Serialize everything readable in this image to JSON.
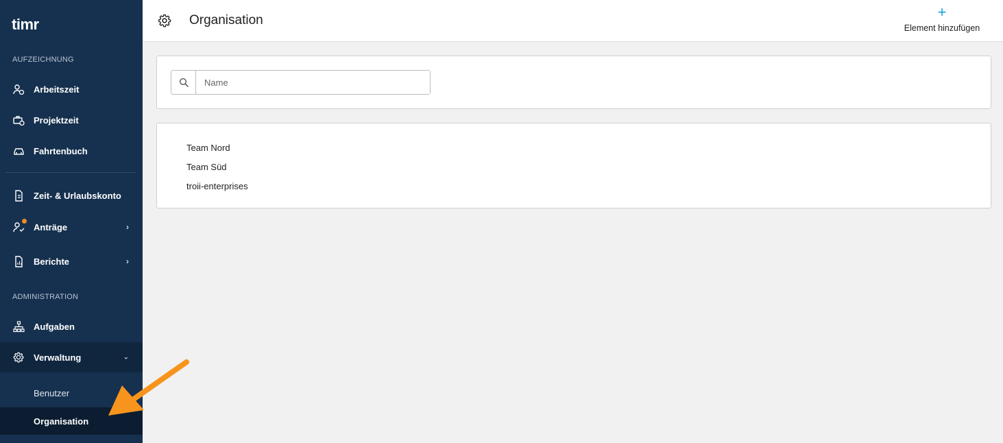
{
  "sidebar": {
    "logo": "timr",
    "sections": {
      "recording": "AUFZEICHNUNG",
      "administration": "ADMINISTRATION"
    },
    "items": {
      "arbeitszeit": "Arbeitszeit",
      "projektzeit": "Projektzeit",
      "fahrtenbuch": "Fahrtenbuch",
      "urlaubskonto": "Zeit- & Urlaubskonto",
      "antraege": "Anträge",
      "berichte": "Berichte",
      "aufgaben": "Aufgaben",
      "verwaltung": "Verwaltung"
    },
    "subitems": {
      "benutzer": "Benutzer",
      "organisation": "Organisation"
    },
    "badge_color": "#f28c1e"
  },
  "header": {
    "title": "Organisation",
    "add_label": "Element hinzufügen",
    "add_icon": "plus-icon",
    "accent": "#1aa1e0"
  },
  "search": {
    "placeholder": "Name",
    "value": ""
  },
  "organisations": [
    "Team Nord",
    "Team Süd",
    "troii-enterprises"
  ],
  "colors": {
    "sidebar_bg": "#16314f",
    "annotation_arrow": "#f7941d"
  }
}
